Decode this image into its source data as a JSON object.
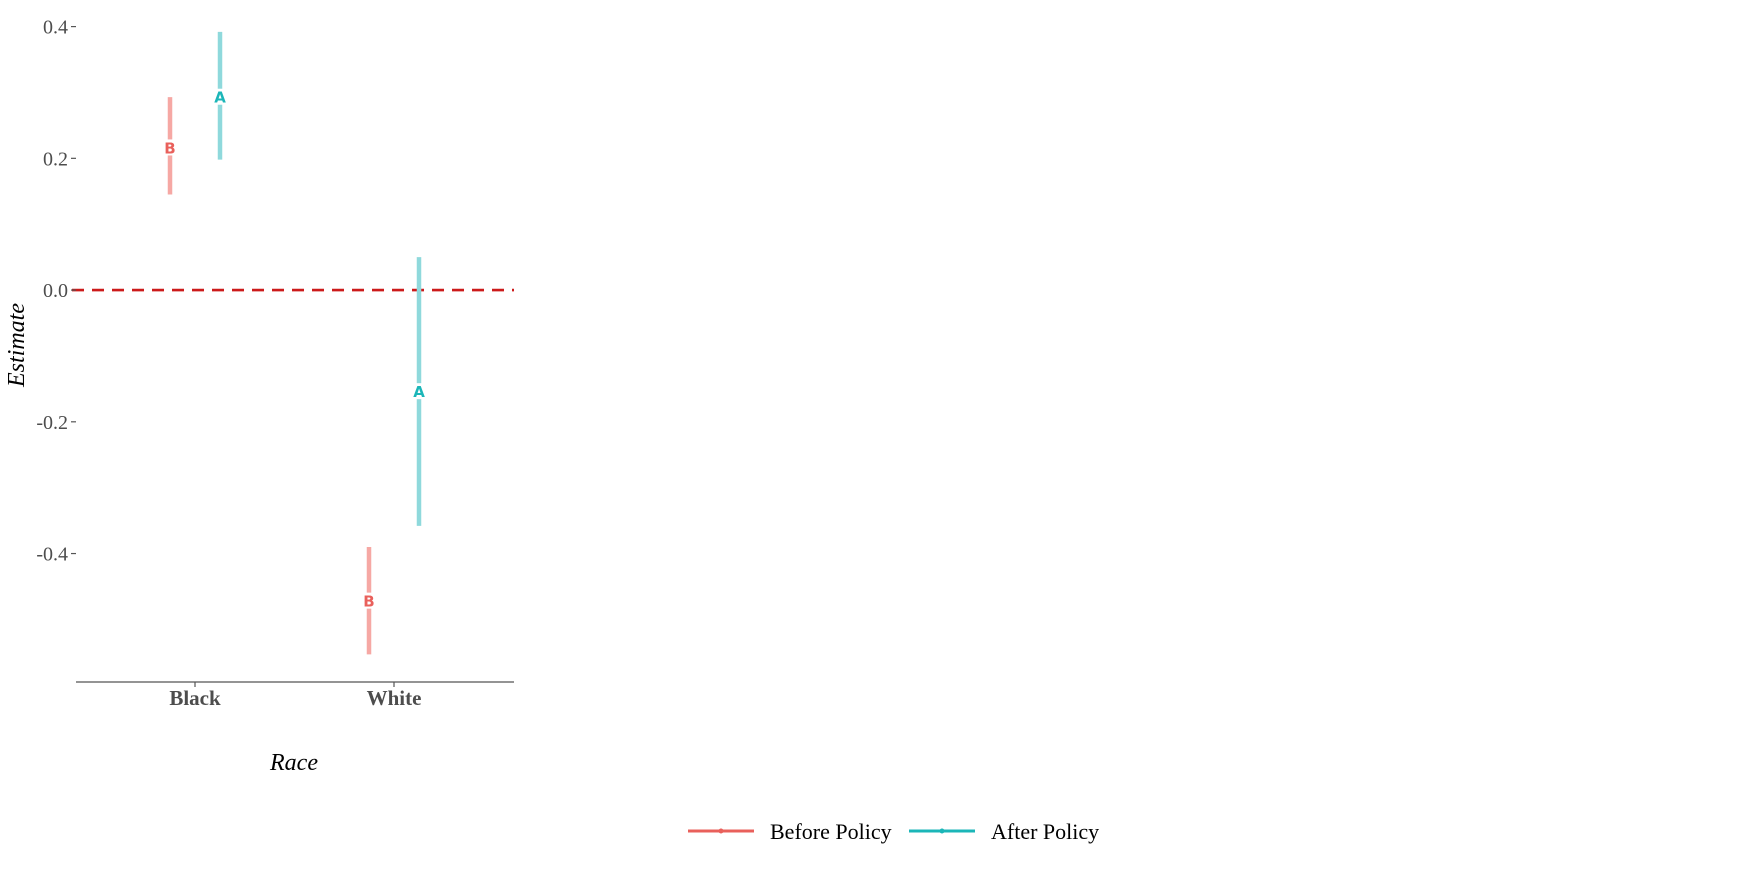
{
  "chart_data": {
    "type": "errorbar",
    "xlabel": "Race",
    "ylabel": "Estimate",
    "categories": [
      "Black",
      "White"
    ],
    "ylim": [
      -0.595,
      0.41
    ],
    "yticks": [
      0.4,
      0.2,
      0.0,
      -0.2,
      -0.4
    ],
    "ytick_labels": [
      "0.4",
      "0.2",
      "0.0",
      "-0.2",
      "-0.4"
    ],
    "reference_line": {
      "y": 0.0,
      "style": "dashed",
      "color": "#cc1a1a"
    },
    "series": [
      {
        "name": "Before Policy",
        "marker": "B",
        "color": "#e9605b",
        "bar_color": "#f6a8a4",
        "points": [
          {
            "category": "Black",
            "estimate": 0.215,
            "lower": 0.145,
            "upper": 0.293
          },
          {
            "category": "White",
            "estimate": -0.473,
            "lower": -0.553,
            "upper": -0.39
          }
        ]
      },
      {
        "name": "After Policy",
        "marker": "A",
        "color": "#1bb6b8",
        "bar_color": "#8fd9dc",
        "points": [
          {
            "category": "Black",
            "estimate": 0.292,
            "lower": 0.198,
            "upper": 0.392
          },
          {
            "category": "White",
            "estimate": -0.155,
            "lower": -0.358,
            "upper": 0.05
          }
        ]
      }
    ],
    "legend_position": "bottom"
  }
}
